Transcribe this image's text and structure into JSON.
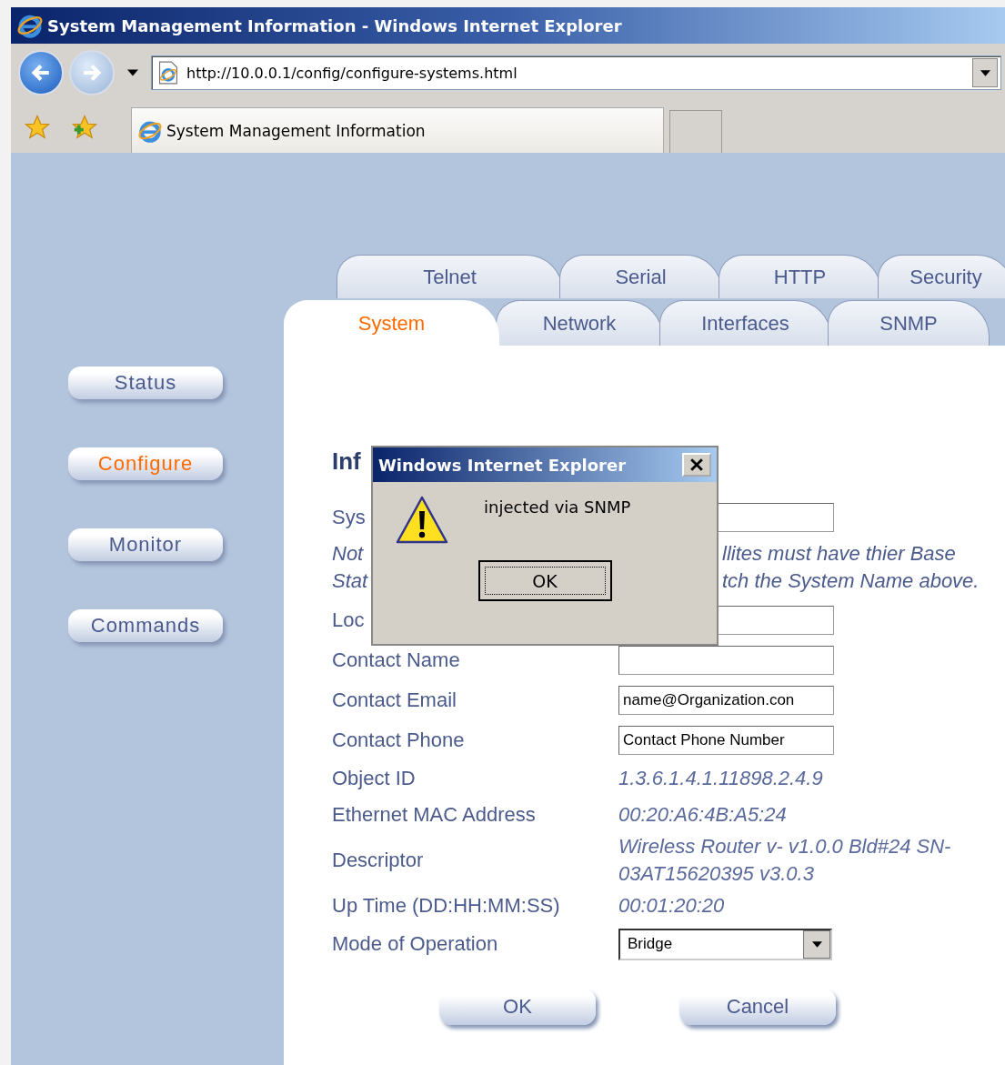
{
  "window": {
    "title": "System Management Information - Windows Internet Explorer"
  },
  "address_bar": {
    "url": "http://10.0.0.1/config/configure-systems.html"
  },
  "browser_tab": {
    "label": "System Management Information"
  },
  "page_tabs": {
    "back_row": [
      {
        "label": "Telnet",
        "selected": false
      },
      {
        "label": "Serial",
        "selected": false
      },
      {
        "label": "HTTP",
        "selected": false
      },
      {
        "label": "Security",
        "selected": false
      }
    ],
    "front_row": [
      {
        "label": "System",
        "selected": true
      },
      {
        "label": "Network",
        "selected": false
      },
      {
        "label": "Interfaces",
        "selected": false
      },
      {
        "label": "SNMP",
        "selected": false
      }
    ]
  },
  "sidebar": [
    {
      "label": "Status",
      "selected": false
    },
    {
      "label": "Configure",
      "selected": true
    },
    {
      "label": "Monitor",
      "selected": false
    },
    {
      "label": "Commands",
      "selected": false
    }
  ],
  "form": {
    "heading": "Inf",
    "rows": [
      {
        "kind": "input",
        "label": "Sys"
      },
      {
        "kind": "note",
        "lines": [
          {
            "left": "Not",
            "right": "llites must have thier Base"
          },
          {
            "left": "Stat",
            "right": "tch the System Name above."
          }
        ]
      },
      {
        "kind": "input",
        "label": "Loc"
      },
      {
        "kind": "input",
        "label": "Contact Name"
      },
      {
        "kind": "input",
        "label": "Contact Email",
        "value": "name@Organization.con"
      },
      {
        "kind": "input",
        "label": "Contact Phone",
        "value": "Contact Phone Number"
      },
      {
        "kind": "readonly",
        "label": "Object ID",
        "value": "1.3.6.1.4.1.11898.2.4.9"
      },
      {
        "kind": "readonly",
        "label": "Ethernet MAC Address",
        "value": "00:20:A6:4B:A5:24"
      },
      {
        "kind": "readonly",
        "label": "Descriptor",
        "value": "Wireless Router v- v1.0.0 Bld#24 SN-03AT15620395 v3.0.3"
      },
      {
        "kind": "readonly",
        "label": "Up Time (DD:HH:MM:SS)",
        "value": "00:01:20:20"
      },
      {
        "kind": "select",
        "label": "Mode of Operation",
        "value": "Bridge"
      }
    ]
  },
  "buttons": [
    "OK",
    "Cancel"
  ],
  "dialog": {
    "title": "Windows Internet Explorer",
    "message": "injected via SNMP",
    "button": "OK"
  }
}
